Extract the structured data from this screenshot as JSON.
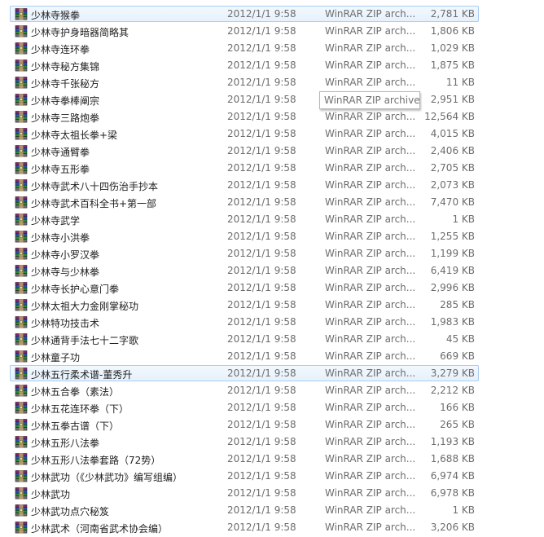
{
  "files": [
    {
      "name": "少林寺猴拳",
      "date": "2012/1/1 9:58",
      "type": "WinRAR ZIP arch...",
      "size": "2,781 KB",
      "selected": true
    },
    {
      "name": "少林寺护身暗器简略其",
      "date": "2012/1/1 9:58",
      "type": "WinRAR ZIP arch...",
      "size": "1,806 KB"
    },
    {
      "name": "少林寺连环拳",
      "date": "2012/1/1 9:58",
      "type": "WinRAR ZIP arch...",
      "size": "1,029 KB"
    },
    {
      "name": "少林寺秘方集锦",
      "date": "2012/1/1 9:58",
      "type": "WinRAR ZIP arch...",
      "size": "1,875 KB"
    },
    {
      "name": "少林寺千张秘方",
      "date": "2012/1/1 9:58",
      "type": "WinRAR ZIP arch...",
      "size": "11 KB"
    },
    {
      "name": "少林寺拳棒阐宗",
      "date": "2012/1/1 9:58",
      "type": "WinRAR ZIP arch...",
      "size": "2,951 KB"
    },
    {
      "name": "少林寺三路炮拳",
      "date": "2012/1/1 9:58",
      "type": "WinRAR ZIP arch...",
      "size": "12,564 KB"
    },
    {
      "name": "少林寺太祖长拳+梁",
      "date": "2012/1/1 9:58",
      "type": "WinRAR ZIP arch...",
      "size": "4,015 KB"
    },
    {
      "name": "少林寺通臂拳",
      "date": "2012/1/1 9:58",
      "type": "WinRAR ZIP arch...",
      "size": "2,406 KB"
    },
    {
      "name": "少林寺五形拳",
      "date": "2012/1/1 9:58",
      "type": "WinRAR ZIP arch...",
      "size": "2,705 KB"
    },
    {
      "name": "少林寺武术八十四伤治手抄本",
      "date": "2012/1/1 9:58",
      "type": "WinRAR ZIP arch...",
      "size": "2,073 KB"
    },
    {
      "name": "少林寺武术百科全书+第一部",
      "date": "2012/1/1 9:58",
      "type": "WinRAR ZIP arch...",
      "size": "7,470 KB"
    },
    {
      "name": "少林寺武学",
      "date": "2012/1/1 9:58",
      "type": "WinRAR ZIP arch...",
      "size": "1 KB"
    },
    {
      "name": "少林寺小洪拳",
      "date": "2012/1/1 9:58",
      "type": "WinRAR ZIP arch...",
      "size": "1,255 KB"
    },
    {
      "name": "少林寺小罗汉拳",
      "date": "2012/1/1 9:58",
      "type": "WinRAR ZIP arch...",
      "size": "1,199 KB"
    },
    {
      "name": "少林寺与少林拳",
      "date": "2012/1/1 9:58",
      "type": "WinRAR ZIP arch...",
      "size": "6,419 KB"
    },
    {
      "name": "少林寺长护心意门拳",
      "date": "2012/1/1 9:58",
      "type": "WinRAR ZIP arch...",
      "size": "2,996 KB"
    },
    {
      "name": "少林太祖大力金刚掌秘功",
      "date": "2012/1/1 9:58",
      "type": "WinRAR ZIP arch...",
      "size": "285 KB"
    },
    {
      "name": "少林特功技击术",
      "date": "2012/1/1 9:58",
      "type": "WinRAR ZIP arch...",
      "size": "1,983 KB"
    },
    {
      "name": "少林通背手法七十二字歌",
      "date": "2012/1/1 9:58",
      "type": "WinRAR ZIP arch...",
      "size": "45 KB"
    },
    {
      "name": "少林童子功",
      "date": "2012/1/1 9:58",
      "type": "WinRAR ZIP arch...",
      "size": "669 KB"
    },
    {
      "name": "少林五行柔术谱-董秀升",
      "date": "2012/1/1 9:58",
      "type": "WinRAR ZIP arch...",
      "size": "3,279 KB",
      "selected": true
    },
    {
      "name": "少林五合拳（素法）",
      "date": "2012/1/1 9:58",
      "type": "WinRAR ZIP arch...",
      "size": "2,212 KB"
    },
    {
      "name": "少林五花连环拳（下）",
      "date": "2012/1/1 9:58",
      "type": "WinRAR ZIP arch...",
      "size": "166 KB"
    },
    {
      "name": "少林五拳古谱（下）",
      "date": "2012/1/1 9:58",
      "type": "WinRAR ZIP arch...",
      "size": "265 KB"
    },
    {
      "name": "少林五形八法拳",
      "date": "2012/1/1 9:58",
      "type": "WinRAR ZIP arch...",
      "size": "1,193 KB"
    },
    {
      "name": "少林五形八法拳套路（72势）",
      "date": "2012/1/1 9:58",
      "type": "WinRAR ZIP arch...",
      "size": "1,688 KB"
    },
    {
      "name": "少林武功（《少林武功》编写组编）",
      "date": "2012/1/1 9:58",
      "type": "WinRAR ZIP arch...",
      "size": "6,974 KB"
    },
    {
      "name": "少林武功",
      "date": "2012/1/1 9:58",
      "type": "WinRAR ZIP arch...",
      "size": "6,978 KB"
    },
    {
      "name": "少林武功点穴秘笈",
      "date": "2012/1/1 9:58",
      "type": "WinRAR ZIP arch...",
      "size": "1 KB"
    },
    {
      "name": "少林武术（河南省武术协会编）",
      "date": "2012/1/1 9:58",
      "type": "WinRAR ZIP arch...",
      "size": "3,206 KB"
    }
  ],
  "tooltip": {
    "text": "WinRAR ZIP archive"
  },
  "colors": {
    "selection_bg": "#e5f0fb",
    "selection_border": "#a9cdf3",
    "secondary_text": "#6d6d6d"
  },
  "icons": {
    "file": "winrar-archive-icon"
  }
}
